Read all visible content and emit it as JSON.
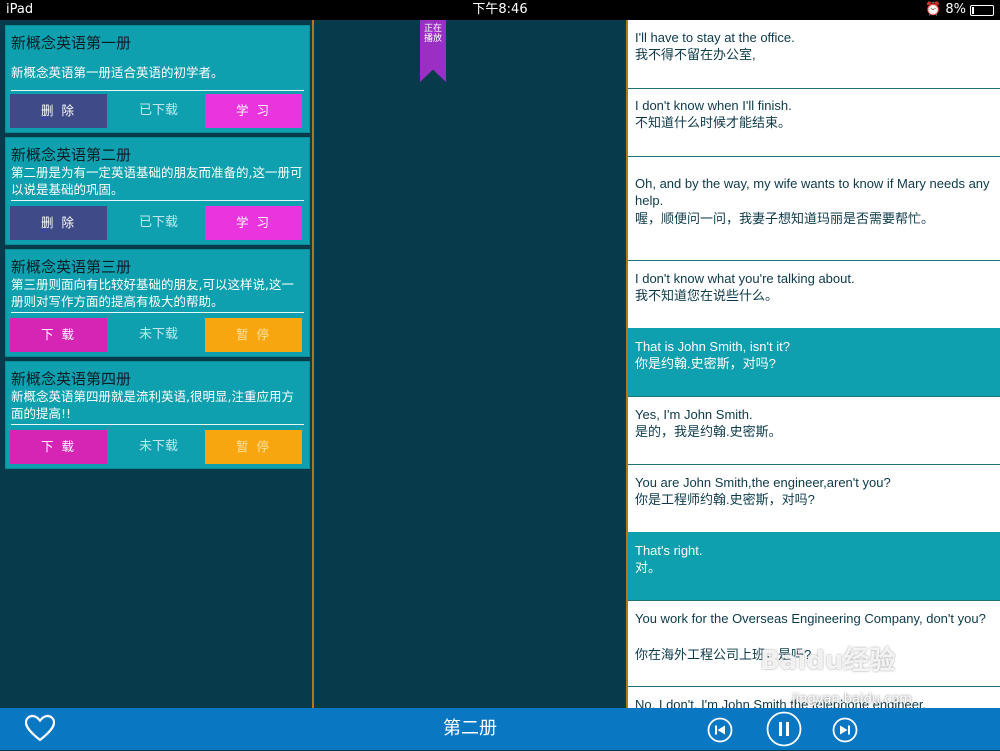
{
  "status": {
    "device": "iPad",
    "time": "下午8:46",
    "battery": "8%"
  },
  "books": [
    {
      "title": "新概念英语第一册",
      "desc": "新概念英语第一册适合英语的初学者。",
      "left_btn": "删 除",
      "state": "已下载",
      "right_btn": "学 习"
    },
    {
      "title": "新概念英语第二册",
      "desc": "第二册是为有一定英语基础的朋友而准备的,这一册可以说是基础的巩固。",
      "left_btn": "删 除",
      "state": "已下载",
      "right_btn": "学 习"
    },
    {
      "title": "新概念英语第三册",
      "desc": "第三册则面向有比较好基础的朋友,可以这样说,这一册则对写作方面的提高有极大的帮助。",
      "left_btn": "下 载",
      "state": "未下载",
      "right_btn": "暂 停"
    },
    {
      "title": "新概念英语第四册",
      "desc": "新概念英语第四册就是流利英语,很明显,注重应用方面的提高!!",
      "left_btn": "下 载",
      "state": "未下载",
      "right_btn": "暂 停"
    }
  ],
  "ribbon": "正在播放",
  "transcript": [
    {
      "en": "I'll have to stay at the office.",
      "zh": "我不得不留在办公室,",
      "highlight": false
    },
    {
      "en": "I don't know when I'll finish.",
      "zh": "不知道什么时候才能结束。",
      "highlight": false
    },
    {
      "en": "Oh, and by the way, my wife wants to know if Mary needs any help.",
      "zh": "喔，顺便问一问，我妻子想知道玛丽是否需要帮忙。",
      "highlight": false
    },
    {
      "en": "I don't know what you're talking about.",
      "zh": "我不知道您在说些什么。",
      "highlight": false
    },
    {
      "en": "That is John Smith, isn't it?",
      "zh": "你是约翰.史密斯，对吗?",
      "highlight": true
    },
    {
      "en": "Yes, I'm John Smith.",
      "zh": "是的，我是约翰.史密斯。",
      "highlight": false
    },
    {
      "en": "You are John Smith,the engineer,aren't you?",
      "zh": "你是工程师约翰.史密斯，对吗?",
      "highlight": false
    },
    {
      "en": "That's right.",
      "zh": "对。",
      "highlight": true
    },
    {
      "en": "You work for the Overseas Engineering Company, don't you?",
      "zh": "你在海外工程公司上班，是吗?",
      "highlight": false
    },
    {
      "en": "No, I don't. I'm John Smith the telephone engineer.",
      "zh": "",
      "highlight": false
    }
  ],
  "bottom": {
    "book_label": "第二册"
  },
  "watermark": {
    "main": "Baidu经验",
    "sub": "jingyan.baidu.com"
  }
}
